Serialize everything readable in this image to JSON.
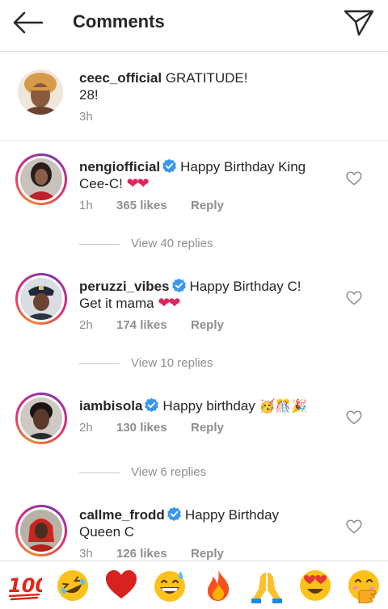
{
  "header": {
    "title": "Comments"
  },
  "caption": {
    "username": "ceec_official",
    "text_line1": "GRATITUDE!",
    "text_line2": "28!",
    "time": "3h"
  },
  "comments": [
    {
      "username": "nengiofficial",
      "verified": true,
      "text_line1": "Happy Birthday King",
      "text_line2": "Cee-C!",
      "hearts": "❤❤",
      "time": "1h",
      "likes": "365 likes",
      "reply": "Reply",
      "view_replies": "View 40 replies"
    },
    {
      "username": "peruzzi_vibes",
      "verified": true,
      "text_line1": "Happy Birthday C!",
      "text_line2": "Get it mama",
      "hearts": "❤❤",
      "time": "2h",
      "likes": "174 likes",
      "reply": "Reply",
      "view_replies": "View 10 replies"
    },
    {
      "username": "iambisola",
      "verified": true,
      "text_line1": "Happy birthday",
      "emojis": "🥳🎊🎉",
      "time": "2h",
      "likes": "130 likes",
      "reply": "Reply",
      "view_replies": "View 6 replies"
    },
    {
      "username": "callme_frodd",
      "verified": true,
      "text_line1": "Happy Birthday",
      "text_line2": "Queen C",
      "time": "3h",
      "likes": "126 likes",
      "reply": "Reply"
    }
  ],
  "emoji_bar": [
    "hundred-points",
    "rolling-laughing",
    "red-heart",
    "grinning-sweat",
    "fire",
    "folded-hands",
    "heart-eyes",
    "hand-over-mouth"
  ],
  "colors": {
    "verified_blue": "#3897f0",
    "heart_red": "#e0245e",
    "ring_gradient": [
      "#f58529",
      "#dd2a7b",
      "#8134af"
    ],
    "muted": "#8e8e8e"
  }
}
